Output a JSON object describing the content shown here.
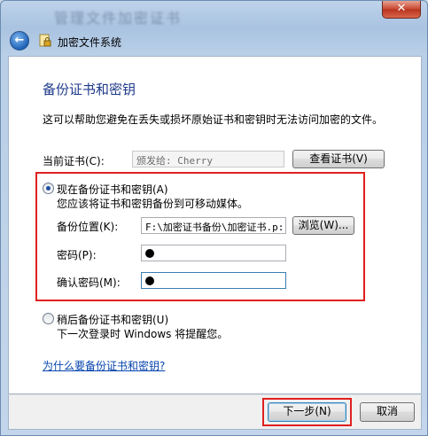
{
  "window": {
    "title_blurred": "管理文件加密证书",
    "close_glyph": "✕"
  },
  "nav": {
    "back_glyph": "←",
    "title": "加密文件系统"
  },
  "page": {
    "heading": "备份证书和密钥",
    "intro": "这可以帮助您避免在丢失或损坏原始证书和密钥时无法访问加密的文件。",
    "current_cert_label": "当前证书(C):",
    "current_cert_value": "颁发给: Cherry",
    "view_cert_button": "查看证书(V)"
  },
  "backup_now": {
    "label": "现在备份证书和密钥(A)",
    "description": "您应该将证书和密钥备份到可移动媒体。",
    "selected": true,
    "location_label": "备份位置(K):",
    "location_value": "F:\\加密证书备份\\加密证书.p:",
    "browse_button": "浏览(W)...",
    "password_label": "密码(P):",
    "confirm_label": "确认密码(M):"
  },
  "backup_later": {
    "label": "稍后备份证书和密钥(U)",
    "description": "下一次登录时 Windows 将提醒您。",
    "selected": false
  },
  "help_link": "为什么要备份证书和密钥?",
  "footer": {
    "next_button": "下一步(N)",
    "cancel_button": "取消"
  },
  "colors": {
    "accent_heading": "#1e3a8a",
    "highlight_border": "#e02020",
    "link": "#0645ad"
  }
}
